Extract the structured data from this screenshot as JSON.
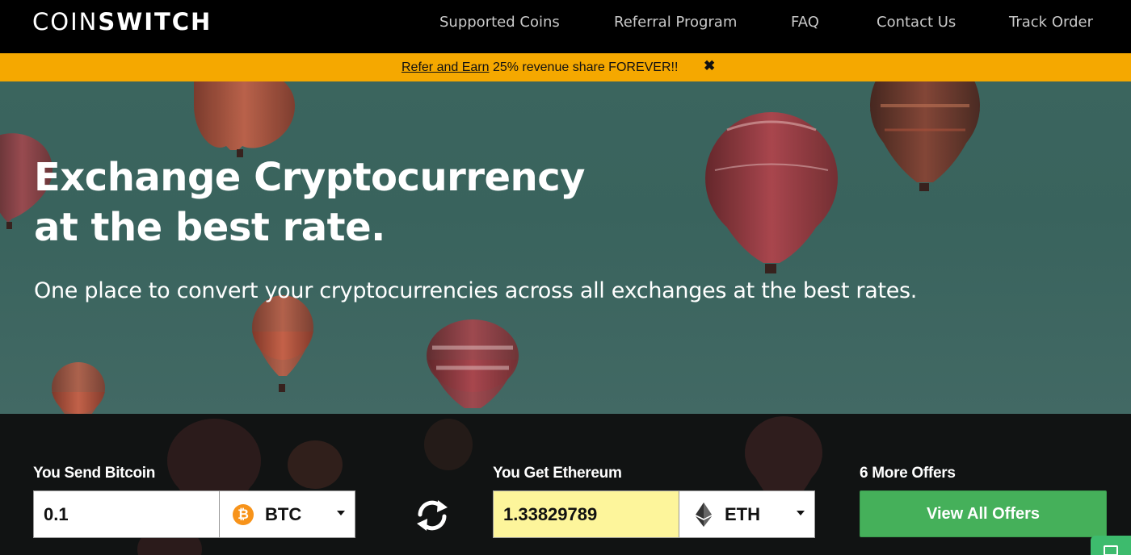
{
  "nav": {
    "logo_light": "COIN",
    "logo_bold": "SWITCH",
    "items": [
      "Supported Coins",
      "Referral Program",
      "FAQ",
      "Contact Us",
      "Track Order"
    ]
  },
  "banner": {
    "link_text": "Refer and Earn",
    "text": " 25% revenue share FOREVER!!",
    "close_icon": "✖",
    "bg_color": "#f5a800"
  },
  "hero": {
    "headline_line1": "Exchange Cryptocurrency",
    "headline_line2": "at the best rate.",
    "subheadline": "One place to convert your cryptocurrencies across all exchanges at the best rates."
  },
  "exchange": {
    "send_label": "You Send Bitcoin",
    "send_amount": "0.1",
    "send_coin": "BTC",
    "send_coin_icon": "bitcoin-icon",
    "swap_icon": "swap-arrows-icon",
    "get_label": "You Get Ethereum",
    "get_amount": "1.33829789",
    "get_coin": "ETH",
    "get_coin_icon": "ethereum-icon",
    "offers_label": "6 More Offers",
    "offers_button": "View All Offers",
    "chat_icon": "chat-icon",
    "accent_color": "#45b05a",
    "highlight_color": "#fdf59b"
  }
}
